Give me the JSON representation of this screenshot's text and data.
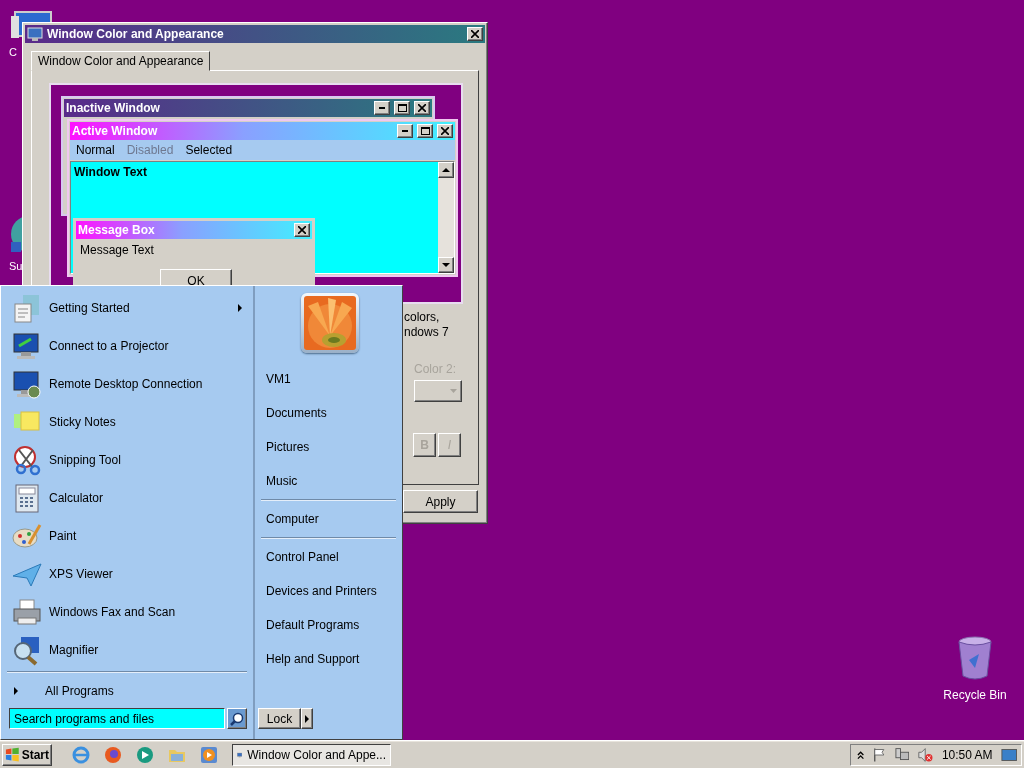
{
  "desktop": {
    "icons": [
      {
        "label": "C"
      },
      {
        "label": "Su"
      }
    ],
    "recycle_bin": {
      "label": "Recycle Bin"
    }
  },
  "dialog": {
    "title": "Window Color and Appearance",
    "tabs": [
      {
        "label": "Window Color and Appearance",
        "selected": true
      }
    ],
    "preview": {
      "inactive_window": {
        "title": "Inactive Window"
      },
      "active_window": {
        "title": "Active Window",
        "menu": [
          {
            "label": "Normal",
            "kind": "normal"
          },
          {
            "label": "Disabled",
            "kind": "disabled"
          },
          {
            "label": "Selected",
            "kind": "selected"
          }
        ],
        "text": "Window Text"
      },
      "message_box": {
        "title": "Message Box",
        "text": "Message Text",
        "button": "OK"
      }
    },
    "description_lines": [
      "colors,",
      "ndows 7"
    ],
    "color_2": {
      "label": "Color 2:",
      "disabled": true
    },
    "font_style_buttons": [
      {
        "label": "B",
        "kind": "bold"
      },
      {
        "label": "I",
        "kind": "italic"
      }
    ],
    "apply_button": "Apply"
  },
  "start_menu": {
    "programs": [
      {
        "label": "Getting Started",
        "submenu": true
      },
      {
        "label": "Connect to a Projector",
        "submenu": false
      },
      {
        "label": "Remote Desktop Connection",
        "submenu": false
      },
      {
        "label": "Sticky Notes",
        "submenu": false
      },
      {
        "label": "Snipping Tool",
        "submenu": false
      },
      {
        "label": "Calculator",
        "submenu": false
      },
      {
        "label": "Paint",
        "submenu": false
      },
      {
        "label": "XPS Viewer",
        "submenu": false
      },
      {
        "label": "Windows Fax and Scan",
        "submenu": false
      },
      {
        "label": "Magnifier",
        "submenu": false
      }
    ],
    "all_programs": "All Programs",
    "search": {
      "placeholder": "Search programs and files"
    },
    "places": [
      {
        "label": "VM1",
        "divider_before": false
      },
      {
        "label": "Documents",
        "divider_before": false
      },
      {
        "label": "Pictures",
        "divider_before": false
      },
      {
        "label": "Music",
        "divider_before": false
      },
      {
        "label": "Computer",
        "divider_before": true
      },
      {
        "label": "Control Panel",
        "divider_before": true
      },
      {
        "label": "Devices and Printers",
        "divider_before": false
      },
      {
        "label": "Default Programs",
        "divider_before": false
      },
      {
        "label": "Help and Support",
        "divider_before": false
      }
    ],
    "lock_button": "Lock"
  },
  "taskbar": {
    "start": "Start",
    "tasks": [
      {
        "label": "Window Color and Appe..."
      }
    ],
    "clock": "10:50 AM"
  }
}
